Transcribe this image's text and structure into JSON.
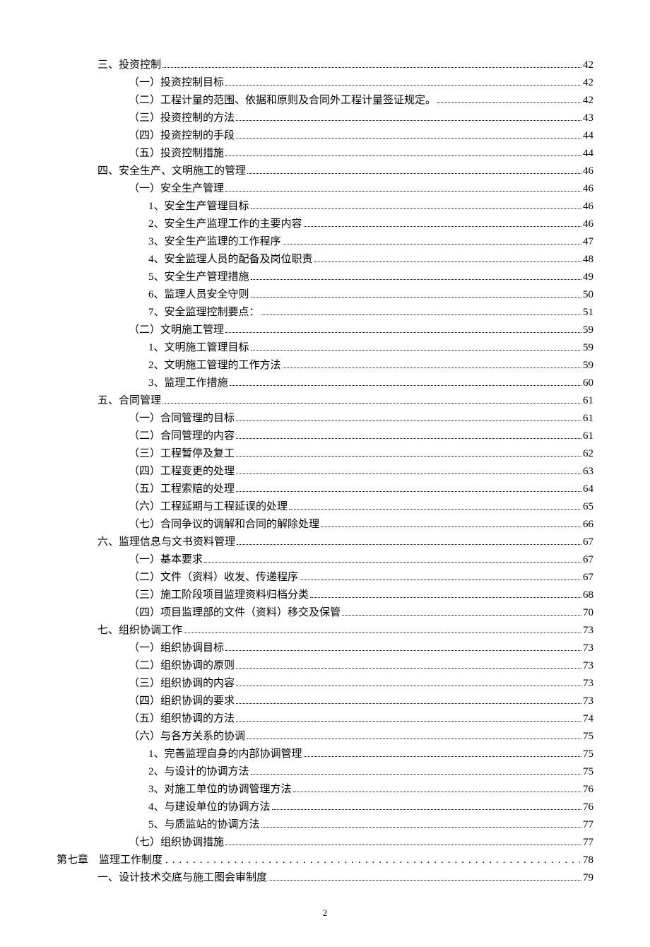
{
  "toc": [
    {
      "indent": 1,
      "text": "三、投资控制",
      "page": "42",
      "style": "solid"
    },
    {
      "indent": 2,
      "text": "（一）投资控制目标",
      "page": "42",
      "style": "solid"
    },
    {
      "indent": 2,
      "text": "（二）工程计量的范围、依据和原则及合同外工程计量签证规定。",
      "page": "42",
      "style": "solid"
    },
    {
      "indent": 2,
      "text": "（三）投资控制的方法",
      "page": "43",
      "style": "solid"
    },
    {
      "indent": 2,
      "text": "（四）投资控制的手段",
      "page": "44",
      "style": "solid"
    },
    {
      "indent": 2,
      "text": "（五）投资控制措施",
      "page": "44",
      "style": "solid"
    },
    {
      "indent": 1,
      "text": "四、安全生产、文明施工的管理",
      "page": "46",
      "style": "solid"
    },
    {
      "indent": 2,
      "text": "（一）安全生产管理",
      "page": "46",
      "style": "solid"
    },
    {
      "indent": 3,
      "text": "1、安全生产管理目标",
      "page": "46",
      "style": "solid"
    },
    {
      "indent": 3,
      "text": "2、安全生产监理工作的主要内容",
      "page": "46",
      "style": "solid"
    },
    {
      "indent": 3,
      "text": "3、安全生产监理的工作程序",
      "page": "47",
      "style": "solid"
    },
    {
      "indent": 3,
      "text": "4、安全监理人员的配备及岗位职责",
      "page": "48",
      "style": "solid"
    },
    {
      "indent": 3,
      "text": "5、安全生产管理措施",
      "page": "49",
      "style": "solid"
    },
    {
      "indent": 3,
      "text": "6、监理人员安全守则",
      "page": "50",
      "style": "solid"
    },
    {
      "indent": 3,
      "text": "7、安全监理控制要点：",
      "page": "51",
      "style": "solid"
    },
    {
      "indent": 2,
      "text": "（二）文明施工管理",
      "page": "59",
      "style": "solid"
    },
    {
      "indent": 3,
      "text": "1、文明施工管理目标",
      "page": "59",
      "style": "solid"
    },
    {
      "indent": 3,
      "text": "2、文明施工管理的工作方法",
      "page": "59",
      "style": "solid"
    },
    {
      "indent": 3,
      "text": "3、监理工作措施",
      "page": "60",
      "style": "solid"
    },
    {
      "indent": 1,
      "text": "五、合同管理",
      "page": "61",
      "style": "solid"
    },
    {
      "indent": 2,
      "text": "（一）合同管理的目标",
      "page": "61",
      "style": "solid"
    },
    {
      "indent": 2,
      "text": "（二）合同管理的内容",
      "page": "61",
      "style": "solid"
    },
    {
      "indent": 2,
      "text": "（三）工程暂停及复工",
      "page": "62",
      "style": "solid"
    },
    {
      "indent": 2,
      "text": "（四）工程变更的处理",
      "page": "63",
      "style": "solid"
    },
    {
      "indent": 2,
      "text": "（五）工程索赔的处理",
      "page": "64",
      "style": "solid"
    },
    {
      "indent": 2,
      "text": "（六）工程延期与工程延误的处理",
      "page": "65",
      "style": "solid"
    },
    {
      "indent": 2,
      "text": "（七）合同争议的调解和合同的解除处理",
      "page": "66",
      "style": "solid"
    },
    {
      "indent": 1,
      "text": "六、监理信息与文书资料管理",
      "page": "67",
      "style": "solid"
    },
    {
      "indent": 2,
      "text": "（一）基本要求",
      "page": "67",
      "style": "solid"
    },
    {
      "indent": 2,
      "text": "（二）文件（资料）收发、传递程序",
      "page": "67",
      "style": "solid"
    },
    {
      "indent": 2,
      "text": "（三）施工阶段项目监理资料归档分类",
      "page": "68",
      "style": "solid"
    },
    {
      "indent": 2,
      "text": "（四）项目监理部的文件（资料）移交及保管",
      "page": "70",
      "style": "solid"
    },
    {
      "indent": 1,
      "text": "七、组织协调工作",
      "page": "73",
      "style": "solid"
    },
    {
      "indent": 2,
      "text": "（一）组织协调目标",
      "page": "73",
      "style": "solid"
    },
    {
      "indent": 2,
      "text": "（二）组织协调的原则",
      "page": "73",
      "style": "solid"
    },
    {
      "indent": 2,
      "text": "（三）组织协调的内容",
      "page": "73",
      "style": "solid"
    },
    {
      "indent": 2,
      "text": "（四）组织协调的要求",
      "page": "73",
      "style": "solid"
    },
    {
      "indent": 2,
      "text": "（五）组织协调的方法",
      "page": "74",
      "style": "solid"
    },
    {
      "indent": 2,
      "text": "（六）与各方关系的协调",
      "page": "75",
      "style": "solid"
    },
    {
      "indent": 3,
      "text": "1、完善监理自身的内部协调管理",
      "page": "75",
      "style": "solid"
    },
    {
      "indent": 3,
      "text": "2、与设计的协调方法",
      "page": "75",
      "style": "solid"
    },
    {
      "indent": 3,
      "text": "3、对施工单位的协调管理方法",
      "page": "76",
      "style": "solid"
    },
    {
      "indent": 3,
      "text": "4、与建设单位的协调方法",
      "page": "76",
      "style": "solid"
    },
    {
      "indent": 3,
      "text": "5、与质监站的协调方法",
      "page": "77",
      "style": "solid"
    },
    {
      "indent": 2,
      "text": "（七）组织协调措施",
      "page": "77",
      "style": "solid"
    },
    {
      "indent": 0,
      "text": "第七章　监理工作制度",
      "page": "78",
      "style": "spaced"
    },
    {
      "indent": 1,
      "text": "一、设计技术交底与施工图会审制度",
      "page": "79",
      "style": "solid"
    }
  ],
  "footer": {
    "pageNumber": "2"
  }
}
